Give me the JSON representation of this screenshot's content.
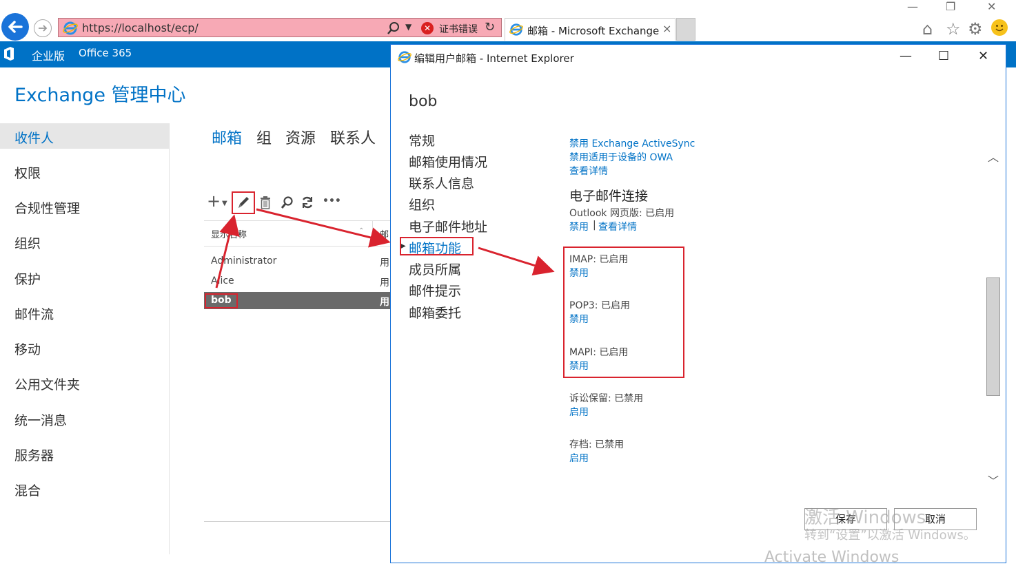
{
  "browser": {
    "url": "https://localhost/ecp/",
    "cert_error": "证书错误",
    "tab_title": "邮箱 - Microsoft Exchange",
    "tab_close": "×"
  },
  "ecp": {
    "edition": "企业版",
    "office365": "Office 365",
    "title": "Exchange 管理中心"
  },
  "left_nav": [
    "收件人",
    "权限",
    "合规性管理",
    "组织",
    "保护",
    "邮件流",
    "移动",
    "公用文件夹",
    "统一消息",
    "服务器",
    "混合"
  ],
  "sub_tabs": [
    "邮箱",
    "组",
    "资源",
    "联系人"
  ],
  "toolbar_more": "•••",
  "grid": {
    "col_display_name": "显示名称",
    "col_second": "邮",
    "rows": [
      {
        "name": "Administrator",
        "type": "用"
      },
      {
        "name": "Alice",
        "type": "用"
      },
      {
        "name": "bob",
        "type": "用"
      }
    ]
  },
  "dialog": {
    "title": "编辑用户邮箱 - Internet Explorer",
    "user_name": "bob",
    "nav": [
      "常规",
      "邮箱使用情况",
      "联系人信息",
      "组织",
      "电子邮件地址",
      "邮箱功能",
      "成员所属",
      "邮件提示",
      "邮箱委托"
    ],
    "content": {
      "disable_eas": "禁用 Exchange ActiveSync",
      "disable_owa_devices": "禁用适用于设备的 OWA",
      "view_details": "查看详情",
      "email_connect_title": "电子邮件连接",
      "owa_status": "Outlook 网页版: 已启用",
      "owa_disable": "禁用",
      "owa_sep": "|",
      "owa_details": "查看详情",
      "imap_status": "IMAP: 已启用",
      "imap_action": "禁用",
      "pop3_status": "POP3: 已启用",
      "pop3_action": "禁用",
      "mapi_status": "MAPI: 已启用",
      "mapi_action": "禁用",
      "lit_status": "诉讼保留: 已禁用",
      "lit_action": "启用",
      "archive_status": "存档: 已禁用",
      "archive_action": "启用"
    },
    "save": "保存",
    "cancel": "取消"
  },
  "watermark": {
    "line1": "激活 Windows",
    "line2": "转到“设置”以激活 Windows。",
    "line3": "Activate Windows"
  },
  "colors": {
    "accent": "#0072c6",
    "address_error": "#f7a9b5",
    "annotation": "#d9232e"
  }
}
